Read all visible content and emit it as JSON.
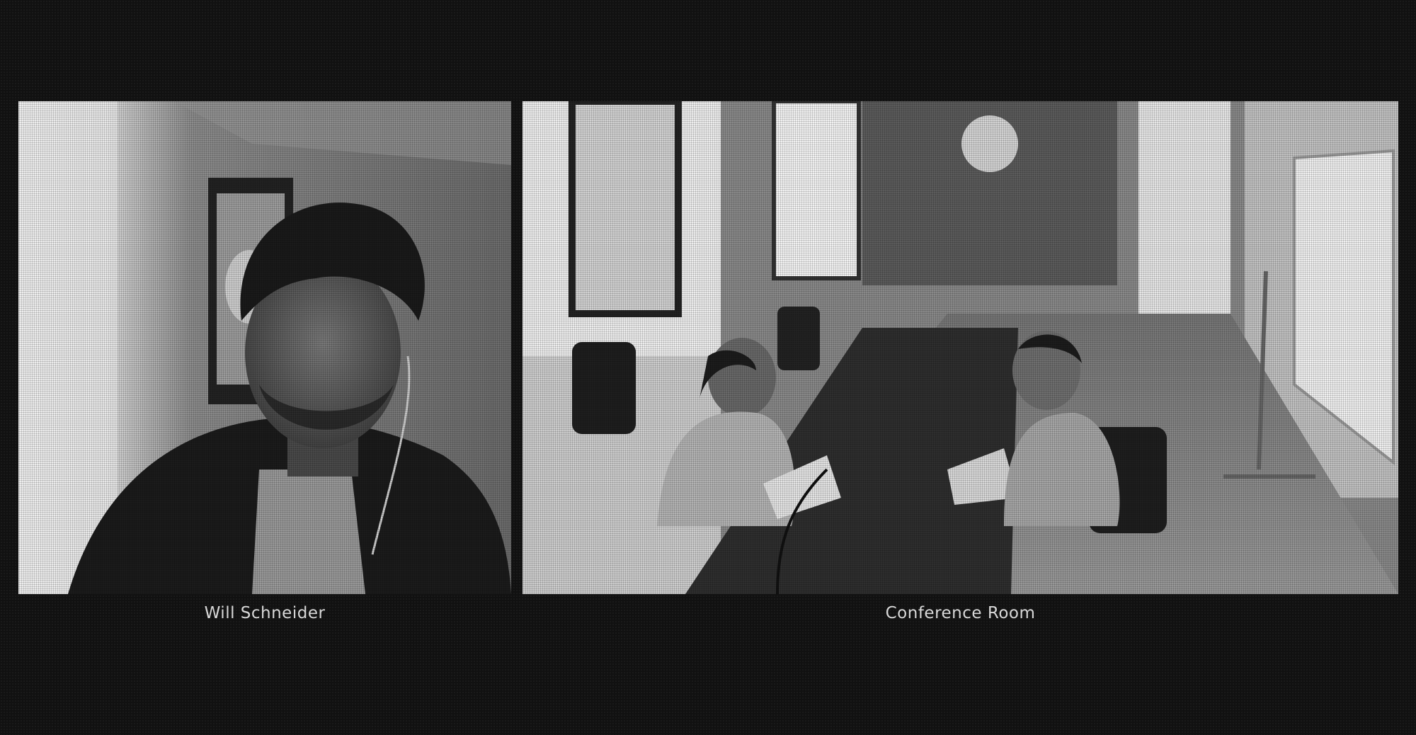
{
  "participants": [
    {
      "name": "Will Schneider"
    },
    {
      "name": "Conference Room"
    }
  ]
}
